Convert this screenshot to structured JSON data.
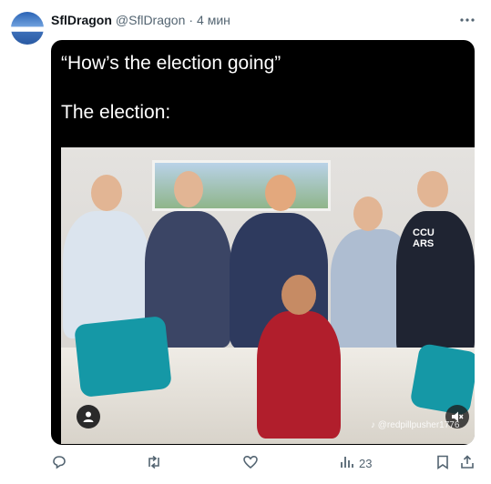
{
  "tweet": {
    "display_name": "SflDragon",
    "handle": "@SflDragon",
    "separator": "·",
    "time": "4 мин",
    "more_icon": "more-horizontal-icon"
  },
  "media": {
    "caption_line1": "“How’s the election going”",
    "caption_line2": "The election:",
    "watermark": "♪ @redpillpusher1776",
    "shirt_text": "CCU\nARS",
    "user_tag_icon": "person-icon",
    "mute_icon": "speaker-muted-icon"
  },
  "actions": {
    "reply_icon": "reply-icon",
    "retweet_icon": "retweet-icon",
    "like_icon": "heart-icon",
    "views_icon": "views-chart-icon",
    "views_count": "23",
    "bookmark_icon": "bookmark-icon",
    "share_icon": "share-icon"
  },
  "colors": {
    "text_primary": "#0f1419",
    "text_secondary": "#536471",
    "media_bg": "#000000"
  }
}
